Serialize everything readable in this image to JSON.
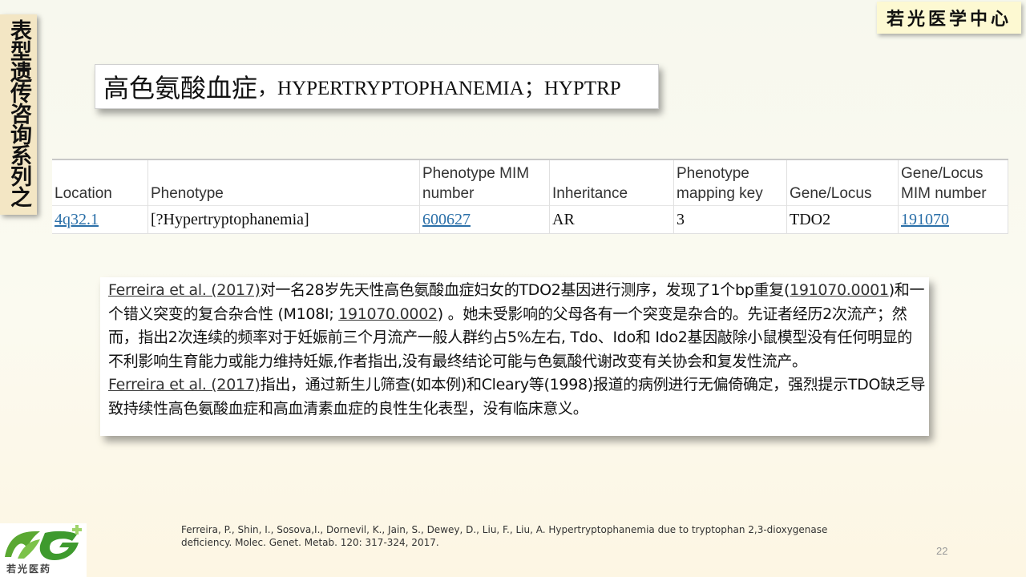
{
  "side_banner": {
    "text": "表型遗传咨询系列之"
  },
  "brand": {
    "text": "若光医学中心"
  },
  "title": {
    "cn": "高色氨酸血症",
    "en": "，HYPERTRYPTOPHANEMIA；HYPTRP"
  },
  "table": {
    "headers": [
      "Location",
      "Phenotype",
      "Phenotype MIM number",
      "Inheritance",
      "Phenotype mapping key",
      "Gene/Locus",
      "Gene/Locus MIM number"
    ],
    "row": {
      "location": "4q32.1",
      "phenotype": "[?Hypertryptophanemia]",
      "phenotype_mim": "600627",
      "inheritance": "AR",
      "mapping_key": "3",
      "gene_locus": "TDO2",
      "gene_mim": "191070"
    }
  },
  "body": {
    "p1_ref": "Ferreira et al. (2017)",
    "p1_a": "对一名28岁先天性高色氨酸血症妇女的TDO2基因进行测序，发现了1个bp重复(",
    "p1_var1": "191070.0001",
    "p1_b": ")和一个错义突变的复合杂合性 (M108I; ",
    "p1_var2": "191070.0002",
    "p1_c": ") 。她未受影响的父母各有一个突变是杂合的。先证者经历2次流产；然而，指出2次连续的频率对于妊娠前三个月流产一般人群约占5%左右, Tdo、Ido和 Ido2基因敲除小鼠模型没有任何明显的不利影响生育能力或能力维持妊娠,作者指出,没有最终结论可能与色氨酸代谢改变有关协会和复发性流产。",
    "p2_ref": "Ferreira et al. (2017)",
    "p2_text": "指出，通过新生儿筛查(如本例)和Cleary等(1998)报道的病例进行无偏倚确定，强烈提示TDO缺乏导致持续性高色氨酸血症和高血清素血症的良性生化表型，没有临床意义。"
  },
  "logo": {
    "caption": "若光医药"
  },
  "citation": "Ferreira, P., Shin, I., Sosova,I., Dornevil, K., Jain, S., Dewey, D., Liu, F., Liu, A. Hypertryptophanemia due to tryptophan 2,3-dioxygenase deficiency. Molec. Genet. Metab. 120: 317-324, 2017.",
  "page_number": "22"
}
